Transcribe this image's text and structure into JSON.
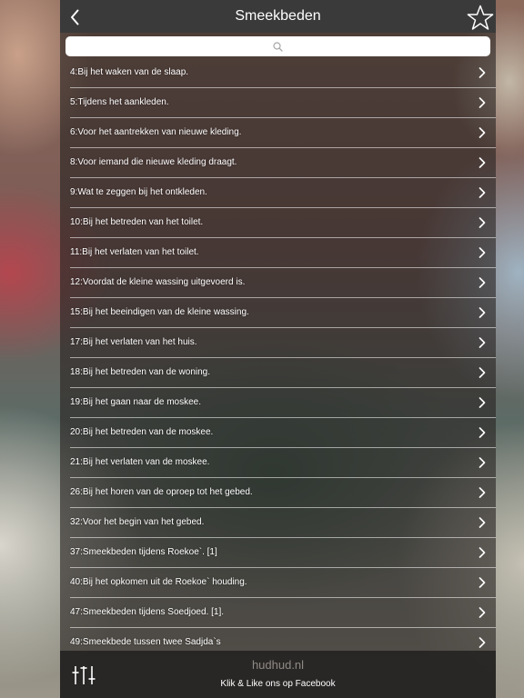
{
  "navbar": {
    "title": "Smeekbeden",
    "back_icon": "chevron-left-icon",
    "favorite_icon": "star-outline-icon"
  },
  "search": {
    "value": "",
    "placeholder": "",
    "icon": "search-icon"
  },
  "list": {
    "items": [
      {
        "label": "4:Bij het waken van de slaap."
      },
      {
        "label": "5:Tijdens het aankleden."
      },
      {
        "label": "6:Voor het aantrekken van nieuwe kleding."
      },
      {
        "label": "8:Voor iemand die nieuwe kleding draagt."
      },
      {
        "label": "9:Wat te zeggen bij het ontkleden."
      },
      {
        "label": "10:Bij het betreden van het toilet."
      },
      {
        "label": "11:Bij het verlaten van het toilet."
      },
      {
        "label": "12:Voordat de kleine wassing uitgevoerd is."
      },
      {
        "label": "15:Bij het beeindigen van de kleine wassing."
      },
      {
        "label": "17:Bij het verlaten van het huis."
      },
      {
        "label": "18:Bij het betreden van de woning."
      },
      {
        "label": "19:Bij het gaan naar de moskee."
      },
      {
        "label": "20:Bij het betreden van de moskee."
      },
      {
        "label": "21:Bij het verlaten van de moskee."
      },
      {
        "label": "26:Bij het horen van de oproep tot het gebed."
      },
      {
        "label": "32:Voor het begin van het gebed."
      },
      {
        "label": "37:Smeekbeden tijdens Roekoe`. [1]"
      },
      {
        "label": "40:Bij het opkomen uit de Roekoe` houding."
      },
      {
        "label": "47:Smeekbeden tijdens Soedjoed. [1]."
      },
      {
        "label": "49:Smeekbede tussen twee Sadjda`s"
      }
    ],
    "chevron_icon": "chevron-right-icon"
  },
  "footer": {
    "brand": "hudhud.nl",
    "facebook_link": "Klik & Like ons op Facebook",
    "settings_icon": "sliders-icon"
  },
  "colors": {
    "navbar_bg": "#3a3a3a",
    "text": "#ffffff",
    "brand_text": "#8e8a86"
  }
}
